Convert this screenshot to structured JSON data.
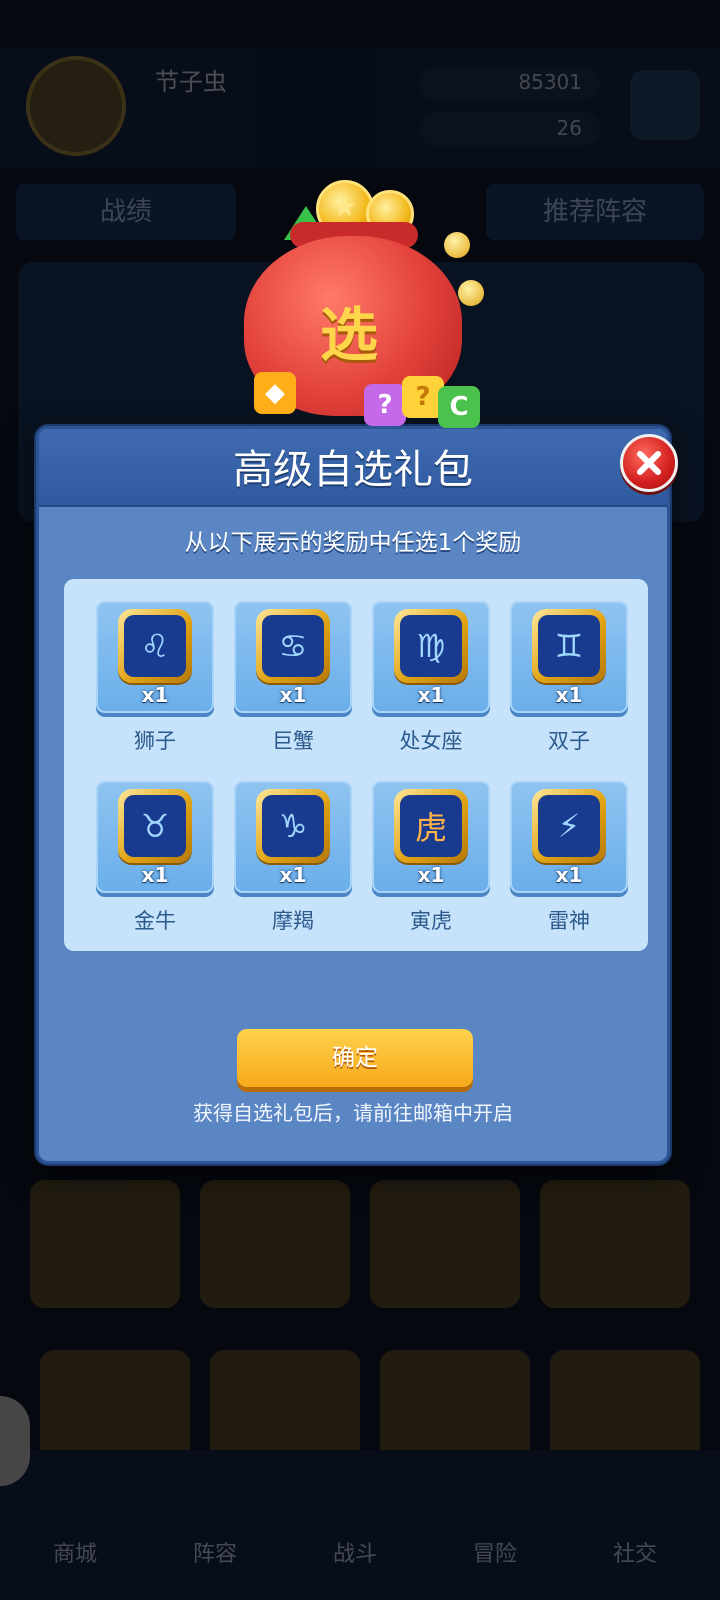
{
  "background": {
    "player_name": "节子虫",
    "currency_1": "85301",
    "currency_2": "26",
    "tabs": [
      "战绩",
      "推荐阵容"
    ],
    "nav": [
      "商城",
      "阵容",
      "战斗",
      "冒险",
      "社交"
    ]
  },
  "gift_bag": {
    "label": "选"
  },
  "dialog": {
    "title": "高级自选礼包",
    "subtitle": "从以下展示的奖励中任选1个奖励",
    "confirm_label": "确定",
    "hint": "获得自选礼包后，请前往邮箱中开启",
    "rewards": [
      {
        "name": "狮子",
        "qty": "x1",
        "icon": "lion-zodiac-icon",
        "glyph": "♌"
      },
      {
        "name": "巨蟹",
        "qty": "x1",
        "icon": "crab-zodiac-icon",
        "glyph": "♋"
      },
      {
        "name": "处女座",
        "qty": "x1",
        "icon": "virgo-zodiac-icon",
        "glyph": "♍"
      },
      {
        "name": "双子",
        "qty": "x1",
        "icon": "gemini-zodiac-icon",
        "glyph": "♊"
      },
      {
        "name": "金牛",
        "qty": "x1",
        "icon": "taurus-zodiac-icon",
        "glyph": "♉"
      },
      {
        "name": "摩羯",
        "qty": "x1",
        "icon": "capricorn-zodiac-icon",
        "glyph": "♑"
      },
      {
        "name": "寅虎",
        "qty": "x1",
        "icon": "tiger-icon",
        "glyph": "虎"
      },
      {
        "name": "雷神",
        "qty": "x1",
        "icon": "thunder-hammer-icon",
        "glyph": "⚡"
      }
    ]
  },
  "colors": {
    "dialog_bg": "#5b86c4",
    "panel_bg": "#c6e3fb",
    "confirm_top": "#ffd24d",
    "confirm_bottom": "#f7a91b",
    "close_red": "#d21f1f"
  }
}
